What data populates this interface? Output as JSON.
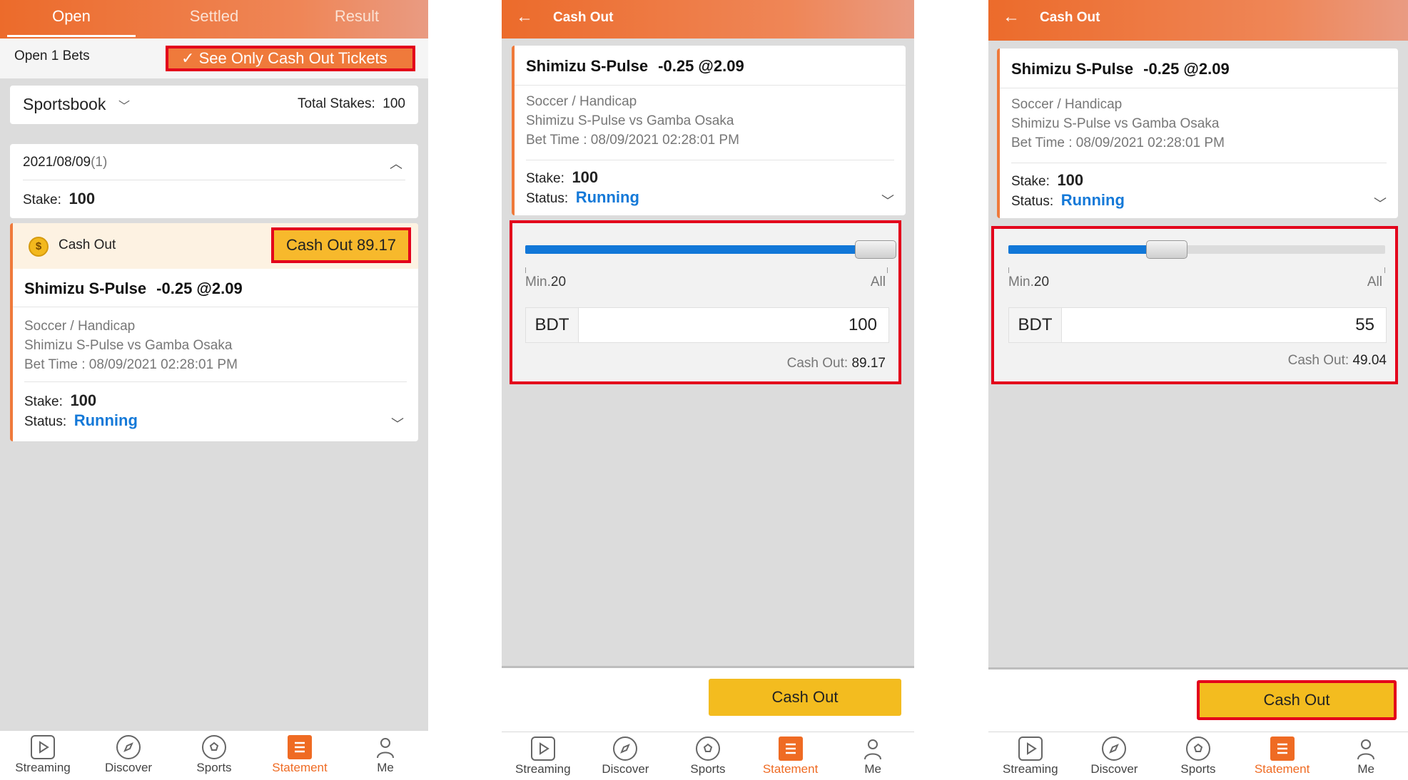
{
  "panel1": {
    "tabs": [
      {
        "label": "Open"
      },
      {
        "label": "Settled"
      },
      {
        "label": "Result"
      }
    ],
    "open_bets_label": "Open 1 Bets",
    "cashout_filter_label": "See Only Cash Out Tickets",
    "sportsbook_label": "Sportsbook",
    "total_stakes_label": "Total Stakes:",
    "total_stakes_value": "100",
    "date": "2021/08/09",
    "date_count": "(1)",
    "stake_label": "Stake:",
    "stake_value": "100",
    "cashout_strip_label": "Cash Out",
    "cashout_button_label": "Cash Out 89.17"
  },
  "bet": {
    "team": "Shimizu S-Pulse",
    "odds": "-0.25 @2.09",
    "market": "Soccer / Handicap",
    "match": "Shimizu S-Pulse vs Gamba Osaka",
    "bet_time": "Bet Time : 08/09/2021 02:28:01 PM",
    "stake_label": "Stake:",
    "stake_value": "100",
    "status_label": "Status:",
    "status_value": "Running"
  },
  "panel2": {
    "title": "Cash Out",
    "min_label": "Min.",
    "min_value": "20",
    "all_label": "All",
    "currency": "BDT",
    "amount": "100",
    "cashout_label": "Cash Out:",
    "cashout_value": "89.17",
    "slider_fraction": 1.0,
    "button_label": "Cash Out"
  },
  "panel3": {
    "title": "Cash Out",
    "min_label": "Min.",
    "min_value": "20",
    "all_label": "All",
    "currency": "BDT",
    "amount": "55",
    "cashout_label": "Cash Out:",
    "cashout_value": "49.04",
    "slider_fraction": 0.4,
    "button_label": "Cash Out"
  },
  "nav": [
    {
      "label": "Streaming",
      "icon": "play-icon"
    },
    {
      "label": "Discover",
      "icon": "compass-icon"
    },
    {
      "label": "Sports",
      "icon": "soccer-ball-icon"
    },
    {
      "label": "Statement",
      "icon": "statement-icon",
      "active": true
    },
    {
      "label": "Me",
      "icon": "person-icon"
    }
  ],
  "colors": {
    "brand_orange": "#ec6b2b",
    "status_blue": "#1479d8",
    "cashout_yellow": "#f3bc1f",
    "highlight_red": "#e3001b"
  }
}
